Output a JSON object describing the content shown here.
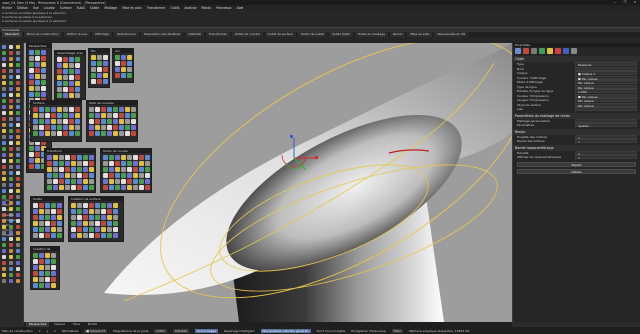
{
  "window": {
    "title": "vase_G4.3dm (4 Mo) - Rhinoceros 8 (Commercial) - [Perspective]",
    "controls": [
      "—",
      "❐",
      "✕"
    ]
  },
  "menu": [
    "Fichier",
    "Édition",
    "Vue",
    "Courbe",
    "Surface",
    "SubD",
    "Solide",
    "Maillage",
    "Mise en plan",
    "Transformer",
    "Outils",
    "Analyse",
    "Rendu",
    "Panneaux",
    "Aide"
  ],
  "command_history": [
    "2 surfaces ouvertes ajoutées à la sélection.",
    "2 surfaces ajoutées à la sélection.",
    "2 surfaces ouvertes ajoutées à la sélection."
  ],
  "command_line": "Commande:",
  "toolbar_tabs": [
    "Standard",
    "Plans de construction",
    "Définir la vue",
    "Affichage",
    "Sélectionner",
    "Disposition des fenêtres",
    "Visibilité",
    "Transformer",
    "Outils de courbe",
    "Outils de surface",
    "Outils de solide",
    "Outils SubD",
    "Outils de maillage",
    "Rendu",
    "Mise en plan",
    "Nouveautés en V8"
  ],
  "active_toolbar_tab": "Standard",
  "viewport": {
    "title": "Perspective"
  },
  "floating_panels": [
    {
      "title": "Perspective"
    },
    {
      "title": "Assemblage avec aj"
    },
    {
      "title": "Mo"
    },
    {
      "title": "Acc"
    },
    {
      "title": "Surface"
    },
    {
      "title": "Outil de courbes"
    },
    {
      "title": "Transform"
    },
    {
      "title": "Outils de courbe"
    },
    {
      "title": "Solide"
    },
    {
      "title": "Création de surface"
    },
    {
      "title": "Création de"
    }
  ],
  "right_panel": {
    "tab": "Propriétés",
    "sections": [
      {
        "title": "Objet",
        "rows": [
          {
            "k": "Type",
            "v": "Plusieurs"
          },
          {
            "k": "Nom",
            "v": ""
          },
          {
            "k": "Calque",
            "v": "■ Calque 1"
          },
          {
            "k": "Couleur d'affichage",
            "v": "■ Par calque"
          },
          {
            "k": "Mode d'affichage",
            "v": "Par calque"
          },
          {
            "k": "Type de ligne",
            "v": "Par calque"
          },
          {
            "k": "Échelle du type de ligne",
            "v": "1.000"
          },
          {
            "k": "Couleur d'impression",
            "v": "■ Par calque"
          },
          {
            "k": "Largeur d'impression",
            "v": "Par calque"
          },
          {
            "k": "Style de section",
            "v": "Par calque"
          },
          {
            "k": "Lien",
            "v": ""
          }
        ]
      },
      {
        "title": "Paramètres du maillage de rendu",
        "rows": [
          {
            "k": "Maillage personnalisé",
            "v": ""
          },
          {
            "k": "Paramètres",
            "v": "Ajuster..."
          }
        ]
      },
      {
        "title": "Rendu",
        "rows": [
          {
            "k": "Projette des ombres",
            "v": "✓"
          },
          {
            "k": "Reçoit des ombres",
            "v": "✓"
          }
        ]
      },
      {
        "title": "Bande isoparamétrique",
        "rows": [
          {
            "k": "Densité",
            "v": "1"
          },
          {
            "k": "Afficher les isoparamétriques",
            "v": "✓"
          }
        ]
      }
    ],
    "buttons": [
      "Expert",
      "Détails"
    ]
  },
  "viewport_tabs": [
    "Perspective",
    "Dessus",
    "Face",
    "Droite"
  ],
  "active_viewport_tab": "Perspective",
  "status_bar": [
    {
      "text": "Plan de construction",
      "style": ""
    },
    {
      "text": "x",
      "style": ""
    },
    {
      "text": "y",
      "style": ""
    },
    {
      "text": "z",
      "style": ""
    },
    {
      "text": "Millimètres",
      "style": ""
    },
    {
      "text": "■ Calque 01",
      "style": "chip"
    },
    {
      "text": "Magnétisme de la grille",
      "style": ""
    },
    {
      "text": "Ortho",
      "style": "chip"
    },
    {
      "text": "Planéité",
      "style": "chip"
    },
    {
      "text": "Accrochages",
      "style": "hl"
    },
    {
      "text": "Repérage intelligent",
      "style": ""
    },
    {
      "text": "Manipulateur (Ajuster général)",
      "style": "hl"
    },
    {
      "text": "Point muni d'objets",
      "style": ""
    },
    {
      "text": "Enregistrer l'historique",
      "style": ""
    },
    {
      "text": "Filtre",
      "style": "chip"
    },
    {
      "text": "Mémoire physique disponible: 15991 Mo",
      "style": ""
    }
  ]
}
